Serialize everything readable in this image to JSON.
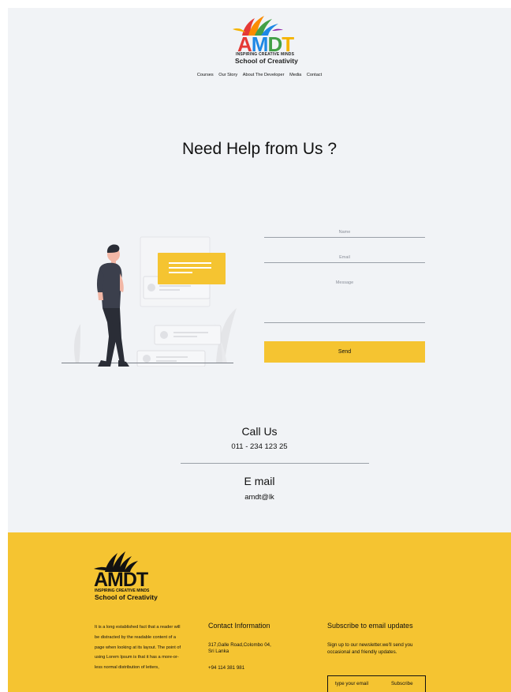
{
  "header": {
    "logo": {
      "letters": [
        "A",
        "M",
        "D",
        "T"
      ],
      "tagline": "INSPIRING CREATIVE MINDS",
      "school": "School of Creativity"
    },
    "nav": [
      "Courses",
      "Our Story",
      "About The Developer",
      "Media",
      "Contact"
    ]
  },
  "main": {
    "headline": "Need Help from Us ?",
    "form": {
      "name_label": "Name",
      "email_label": "Email",
      "message_label": "Message",
      "send_label": "Send"
    },
    "contact": {
      "call_title": "Call Us",
      "call_number": "011 - 234 123 25",
      "email_title": "E mail",
      "email_value": "amdt@lk"
    }
  },
  "footer": {
    "logo": {
      "brand": "AMDT",
      "tagline": "INSPIRING CREATIVE MINDS",
      "school": "School of Creativity"
    },
    "about_text": "It is a long established fact that a reader will be distracted by the readable content of a page when looking at its layout. The point of using Lorem Ipsum is that it has a more-or-less normal distribution of letters,",
    "contact_info": {
      "title": "Contact Information",
      "address_line1": "317,Galle Road,Colombo 04,",
      "address_line2": "Sri Lanka",
      "phone": "+94 114 381 981"
    },
    "newsletter": {
      "title": "Subscribe to email updates",
      "text": "Sign up to our newsletter.we'll send you occasional and friendly updates.",
      "placeholder": "type your email",
      "button": "Subscribe"
    }
  },
  "colors": {
    "accent": "#f5c431",
    "page_bg": "#f1f3f6"
  }
}
